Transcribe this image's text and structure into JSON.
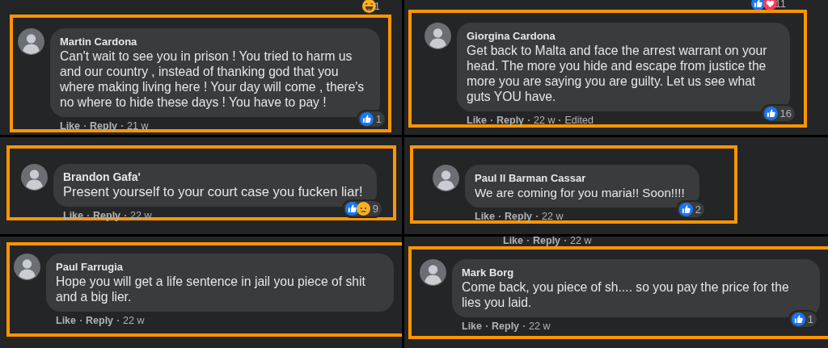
{
  "panels": [
    {
      "prior": {
        "reactions": [
          {
            "kind": "haha"
          }
        ],
        "count": "1"
      },
      "author": "Martin Cardona",
      "text": "Can't wait to see you in prison ! You tried to harm us and our country , instead of thanking god that you where making living here ! Your day will come , there's no where to hide these days ! You have to pay !",
      "actions": [
        "Like",
        "Reply"
      ],
      "time": "21 w",
      "reactions": [
        {
          "kind": "like"
        }
      ],
      "count": "1"
    },
    {
      "prior": {
        "reactions": [
          {
            "kind": "like"
          },
          {
            "kind": "love"
          }
        ],
        "count": "11"
      },
      "author": "Giorgina Cardona",
      "text": "Get back to Malta and face the arrest warrant on your head. The more you hide and escape from justice the more you are saying you are guilty. Let us see what guts YOU have.",
      "actions": [
        "Like",
        "Reply"
      ],
      "time": "22 w",
      "edited": "Edited",
      "reactions": [
        {
          "kind": "like"
        }
      ],
      "count": "16"
    },
    {
      "author": "Brandon Gafa'",
      "text": "Present yourself to your court case you fucken liar!",
      "actions": [
        "Like",
        "Reply"
      ],
      "time": "22 w",
      "reactions": [
        {
          "kind": "like"
        },
        {
          "kind": "sad"
        }
      ],
      "count": "9"
    },
    {
      "author": "Paul Il Barman Cassar",
      "text": "We are coming for you maria!! Soon!!!!",
      "actions": [
        "Like",
        "Reply"
      ],
      "time": "22 w",
      "reactions": [
        {
          "kind": "like"
        }
      ],
      "count": "2"
    },
    {
      "author": "Paul Farrugia",
      "text": "Hope you will get a life sentence in jail you piece of shit and a big lier.",
      "actions": [
        "Like",
        "Reply"
      ],
      "time": "22 w"
    },
    {
      "prior_meta": {
        "actions": [
          "Like",
          "Reply"
        ],
        "time": "22 w"
      },
      "author": "Mark Borg",
      "text": "Come back, you piece of sh.... so you pay the price for the lies you laid.",
      "actions": [
        "Like",
        "Reply"
      ],
      "time": "22 w",
      "reactions": [
        {
          "kind": "like"
        }
      ],
      "count": "1"
    }
  ]
}
